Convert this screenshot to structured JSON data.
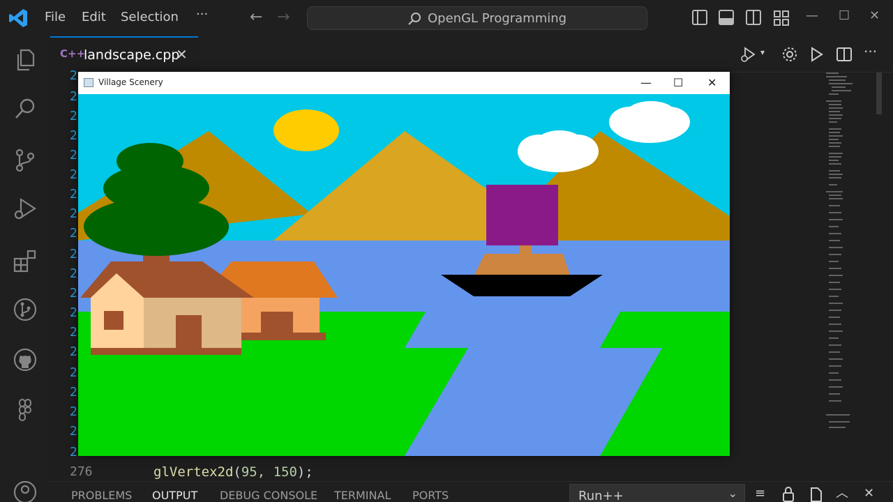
{
  "menu": {
    "file": "File",
    "edit": "Edit",
    "selection": "Selection",
    "more": "···"
  },
  "search": {
    "text": "OpenGL Programming"
  },
  "tab": {
    "icon": "C++",
    "filename": "landscape.cpp"
  },
  "editor": {
    "gutter_prefix": "2",
    "last_line_number": "276",
    "code_func": "glVertex2d",
    "code_args": "95, 150",
    "code_punc_open": "(",
    "code_punc_close": ");"
  },
  "scene_window": {
    "title": "Village Scenery"
  },
  "panel": {
    "tabs": [
      "PROBLEMS",
      "OUTPUT",
      "DEBUG CONSOLE",
      "TERMINAL",
      "PORTS"
    ],
    "active": "OUTPUT",
    "run_target": "Run++"
  },
  "colors": {
    "sky": "#00c8e6",
    "sun": "#ffcc00",
    "mountain_dark": "#bf8a00",
    "mountain_light": "#daa520",
    "water": "#6495ed",
    "grass": "#00d600",
    "tree": "#006400",
    "trunk": "#a0522d",
    "sail": "#8b1a89",
    "accent": "#0078d4"
  },
  "icons": {
    "activity": [
      "explorer-icon",
      "search-icon",
      "source-control-icon",
      "run-debug-icon",
      "extensions-icon",
      "git-graph-icon",
      "github-icon",
      "figma-icon",
      "account-icon"
    ]
  }
}
